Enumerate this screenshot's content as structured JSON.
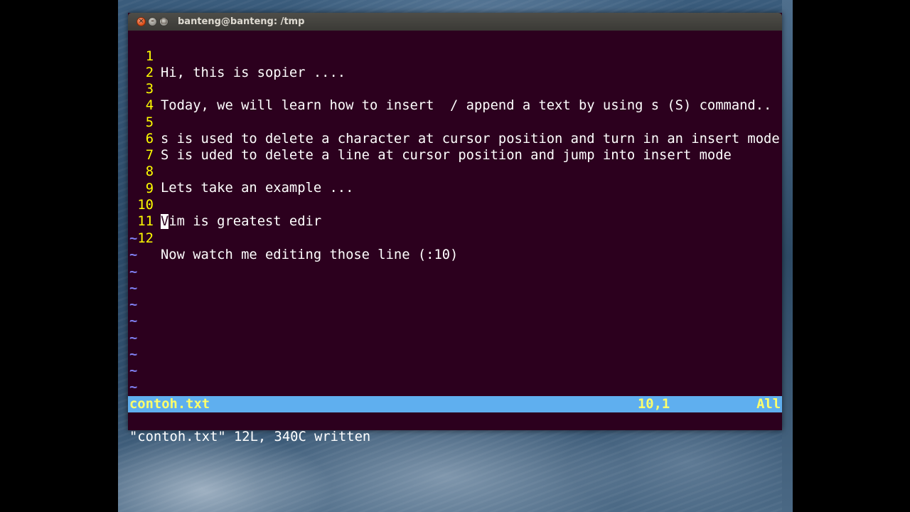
{
  "window": {
    "title": "banteng@banteng: /tmp"
  },
  "editor": {
    "lines": [
      {
        "num": "1",
        "text": "Hi, this is sopier ...."
      },
      {
        "num": "2",
        "text": ""
      },
      {
        "num": "3",
        "text": "Today, we will learn how to insert  / append a text by using s (S) command.."
      },
      {
        "num": "4",
        "text": ""
      },
      {
        "num": "5",
        "text": "s is used to delete a character at cursor position and turn in an insert mode"
      },
      {
        "num": "6",
        "text": "S is uded to delete a line at cursor position and jump into insert mode"
      },
      {
        "num": "7",
        "text": ""
      },
      {
        "num": "8",
        "text": "Lets take an example ..."
      },
      {
        "num": "9",
        "text": ""
      },
      {
        "num": "10",
        "cursor_char": "V",
        "text_after_cursor": "im is greatest edir"
      },
      {
        "num": "11",
        "text": ""
      },
      {
        "num": "12",
        "text": "Now watch me editing those line (:10)"
      }
    ],
    "empty_marker": "~"
  },
  "statusline": {
    "filename": "contoh.txt",
    "position": "10,1",
    "scroll": "All"
  },
  "message": "\"contoh.txt\" 12L, 340C written",
  "colors": {
    "terminal_bg": "#2c001e",
    "line_number": "#ffff00",
    "tilde": "#7f7ff0",
    "statusline_bg": "#5fafef",
    "statusline_fg": "#ffff6a"
  }
}
